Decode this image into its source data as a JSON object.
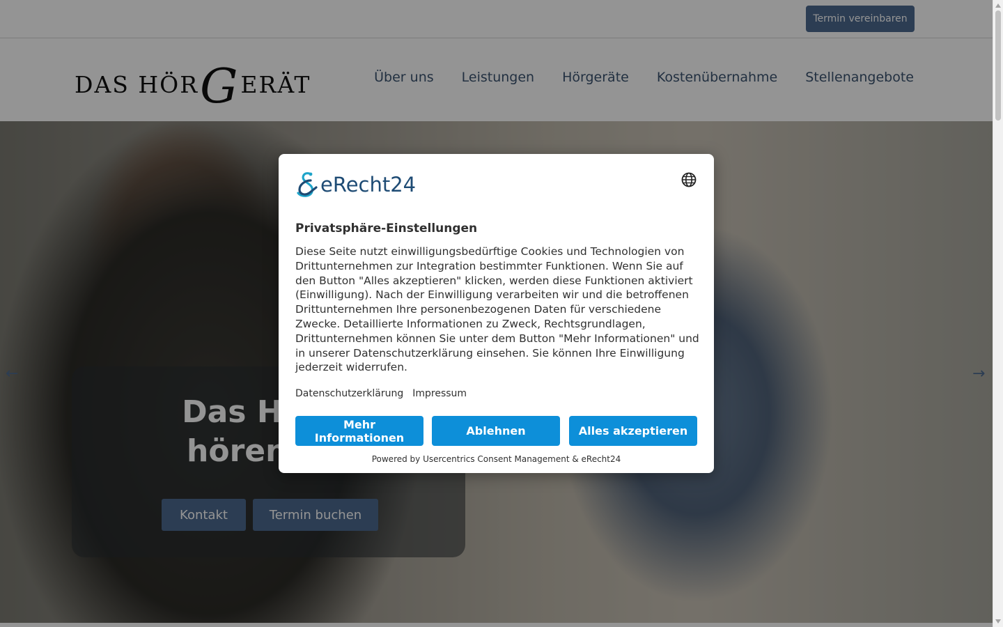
{
  "topbar": {
    "cta_label": "Termin vereinbaren"
  },
  "logo": {
    "part1": "DAS HÖR",
    "letter": "G",
    "part2": "ERÄT"
  },
  "nav": {
    "items": [
      "Über uns",
      "Leistungen",
      "Hörgeräte",
      "Kostenübernahme",
      "Stellenangebote"
    ]
  },
  "hero": {
    "title_line1": "Das Hörge",
    "title_line2": "hören. Gu",
    "btn_contact": "Kontakt",
    "btn_book": "Termin buchen"
  },
  "consent": {
    "brand": "eRecht24",
    "title": "Privatsphäre-Einstellungen",
    "body": "Diese Seite nutzt einwilligungsbedürftige Cookies und Technologien von Drittunternehmen zur Integration bestimmter Funktionen. Wenn Sie auf den Button \"Alles akzeptieren\" klicken, werden diese Funktionen aktiviert (Einwilligung). Nach der Einwilligung verarbeiten wir und die betroffenen Drittunternehmen Ihre personenbezogenen Daten für verschiedene Zwecke. Detaillierte Informationen zu Zweck, Rechtsgrundlagen, Drittunternehmen können Sie unter dem Button \"Mehr Informationen\" und in unserer Datenschutzerklärung einsehen. Sie können Ihre Einwilligung jederzeit widerrufen.",
    "link_privacy": "Datenschutzerklärung",
    "link_imprint": "Impressum",
    "btn_more": "Mehr Informationen",
    "btn_decline": "Ablehnen",
    "btn_accept": "Alles akzeptieren",
    "powered": "Powered by Usercentrics Consent Management & eRecht24",
    "lang_icon": "globe-icon"
  },
  "colors": {
    "accent_button": "#0d8fd9",
    "site_primary": "#4d6a8f",
    "nav_text": "#3b5470",
    "brand_text": "#1e4b74"
  }
}
